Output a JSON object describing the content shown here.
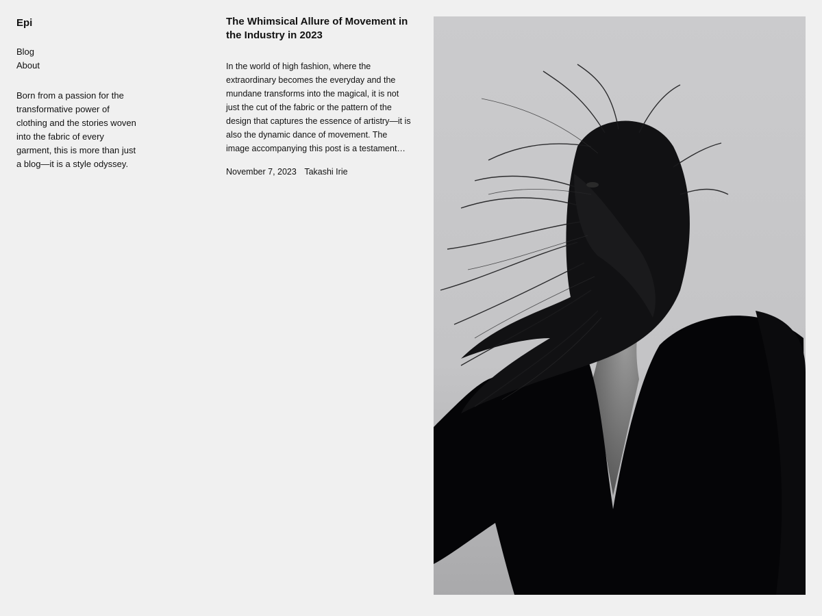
{
  "site": {
    "title": "Epi"
  },
  "nav": {
    "items": [
      {
        "label": "Blog"
      },
      {
        "label": "About"
      }
    ]
  },
  "tagline": "Born from a passion for the transformative power of clothing and the stories woven into the fabric of every garment, this is more than just a blog—it is a style odyssey.",
  "post": {
    "title": "The Whimsical Allure of Movement in the Industry in 2023",
    "excerpt": "In the world of high fashion, where the extraordinary becomes the everyday and the mundane transforms into the magical, it is not just the cut of the fabric or the pattern of the design that captures the essence of artistry—it is also the dynamic dance of movement. The image accompanying this post is a testament…",
    "date": "November 7, 2023",
    "author": "Takashi Irie"
  },
  "colors": {
    "background": "#f0f0f0",
    "text": "#111111",
    "photo_sky": "#c9c9cb",
    "photo_dark": "#050507"
  }
}
